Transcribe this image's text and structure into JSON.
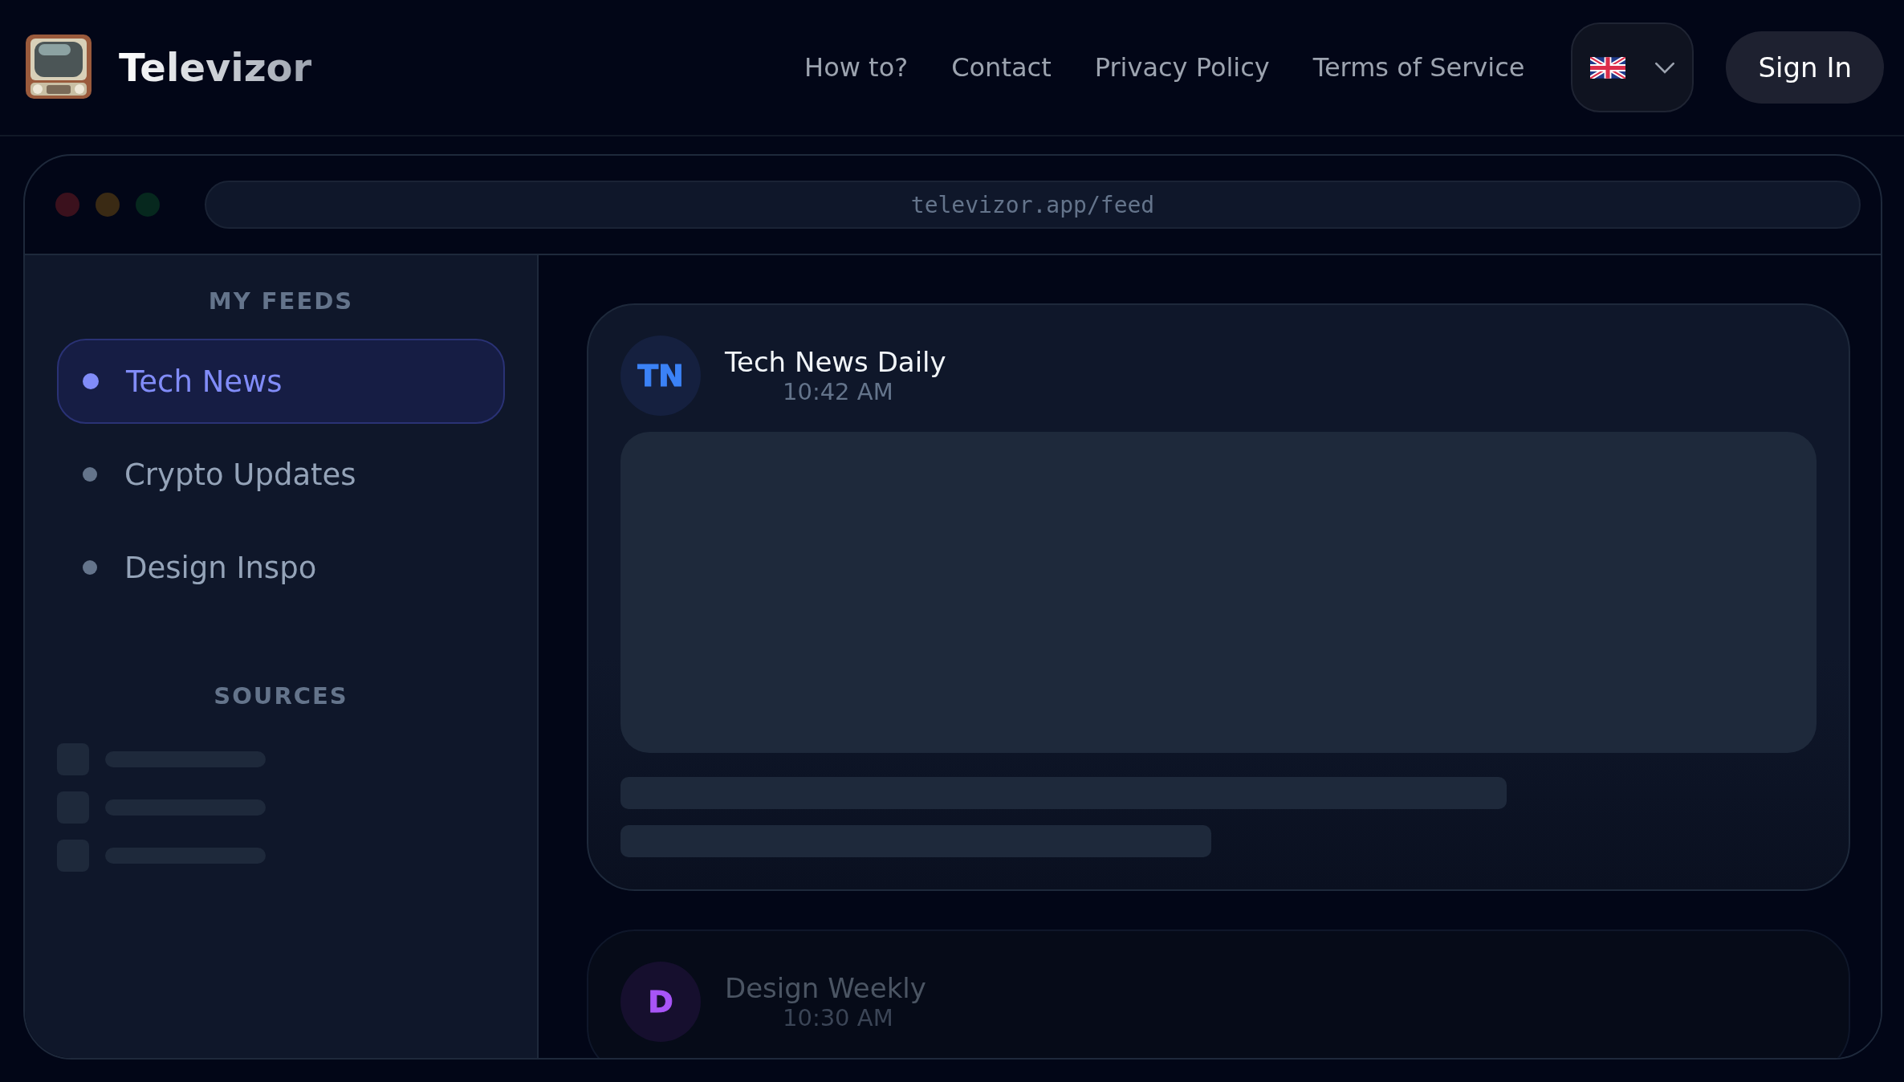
{
  "brand": {
    "name": "Televizor"
  },
  "nav": [
    {
      "label": "How to?"
    },
    {
      "label": "Contact"
    },
    {
      "label": "Privacy Policy"
    },
    {
      "label": "Terms of Service"
    }
  ],
  "sign_in": {
    "label": "Sign In"
  },
  "browser": {
    "url": "televizor.app/feed"
  },
  "sidebar": {
    "sections": [
      {
        "title": "MY FEEDS",
        "kind": "feeds",
        "items": [
          {
            "label": "Tech News",
            "selected": true
          },
          {
            "label": "Crypto Updates",
            "selected": false
          },
          {
            "label": "Design Inspo",
            "selected": false
          }
        ]
      },
      {
        "title": "SOURCES",
        "kind": "skeleton"
      }
    ]
  },
  "posts": [
    {
      "initials": "TN",
      "source": "Tech News Daily",
      "time": "10:42 AM",
      "color": "#3b82f6",
      "faded": false
    },
    {
      "initials": "D",
      "source": "Design Weekly",
      "time": "10:30 AM",
      "color": "#a855f7",
      "faded": true
    }
  ]
}
